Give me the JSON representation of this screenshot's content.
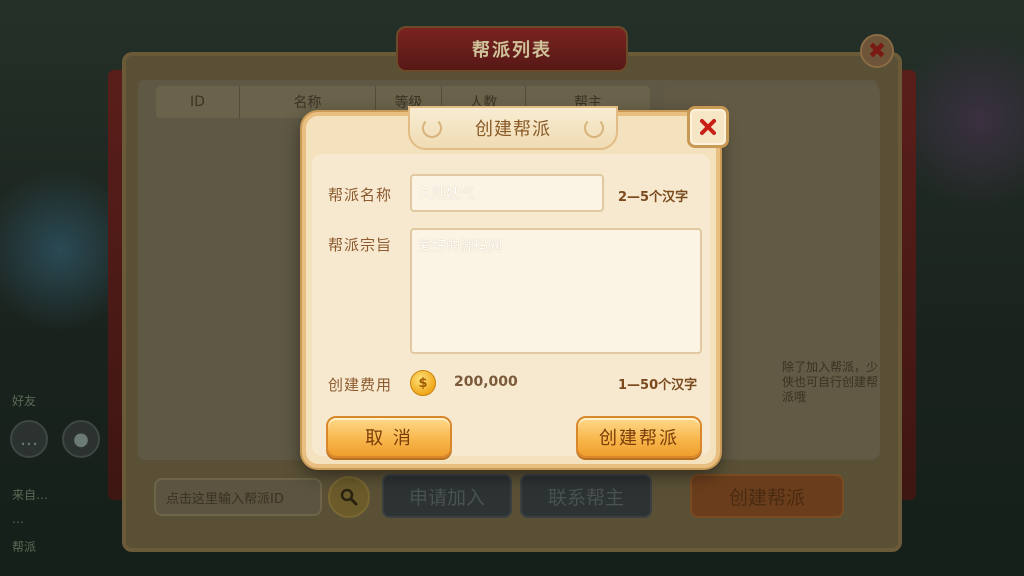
{
  "background": {
    "chat_lines": [
      "来自…",
      "…",
      "帮派"
    ],
    "side_label": "好友"
  },
  "guild_list": {
    "title": "帮派列表",
    "columns": [
      "ID",
      "名称",
      "等级",
      "人数",
      "帮主"
    ],
    "search_placeholder": "点击这里输入帮派ID",
    "apply_button": "申请加入",
    "contact_button": "联系帮主",
    "create_button": "创建帮派",
    "info_text": "除了加入帮派，少侠也可自行创建帮派哦"
  },
  "create_dialog": {
    "title": "创建帮派",
    "name_label": "帮派名称",
    "name_value": "久则妖气",
    "name_hint": "2—5个汉字",
    "motto_label": "帮派宗旨",
    "motto_value": "爱好的源码网",
    "cost_label": "创建费用",
    "cost_value": "200,000",
    "motto_hint": "1—50个汉字",
    "cancel_button": "取 消",
    "confirm_button": "创建帮派"
  },
  "colors": {
    "dialog_bg": "#f4e1be",
    "button_orange": "#f7b448",
    "label_brown": "#8c5a2e"
  }
}
